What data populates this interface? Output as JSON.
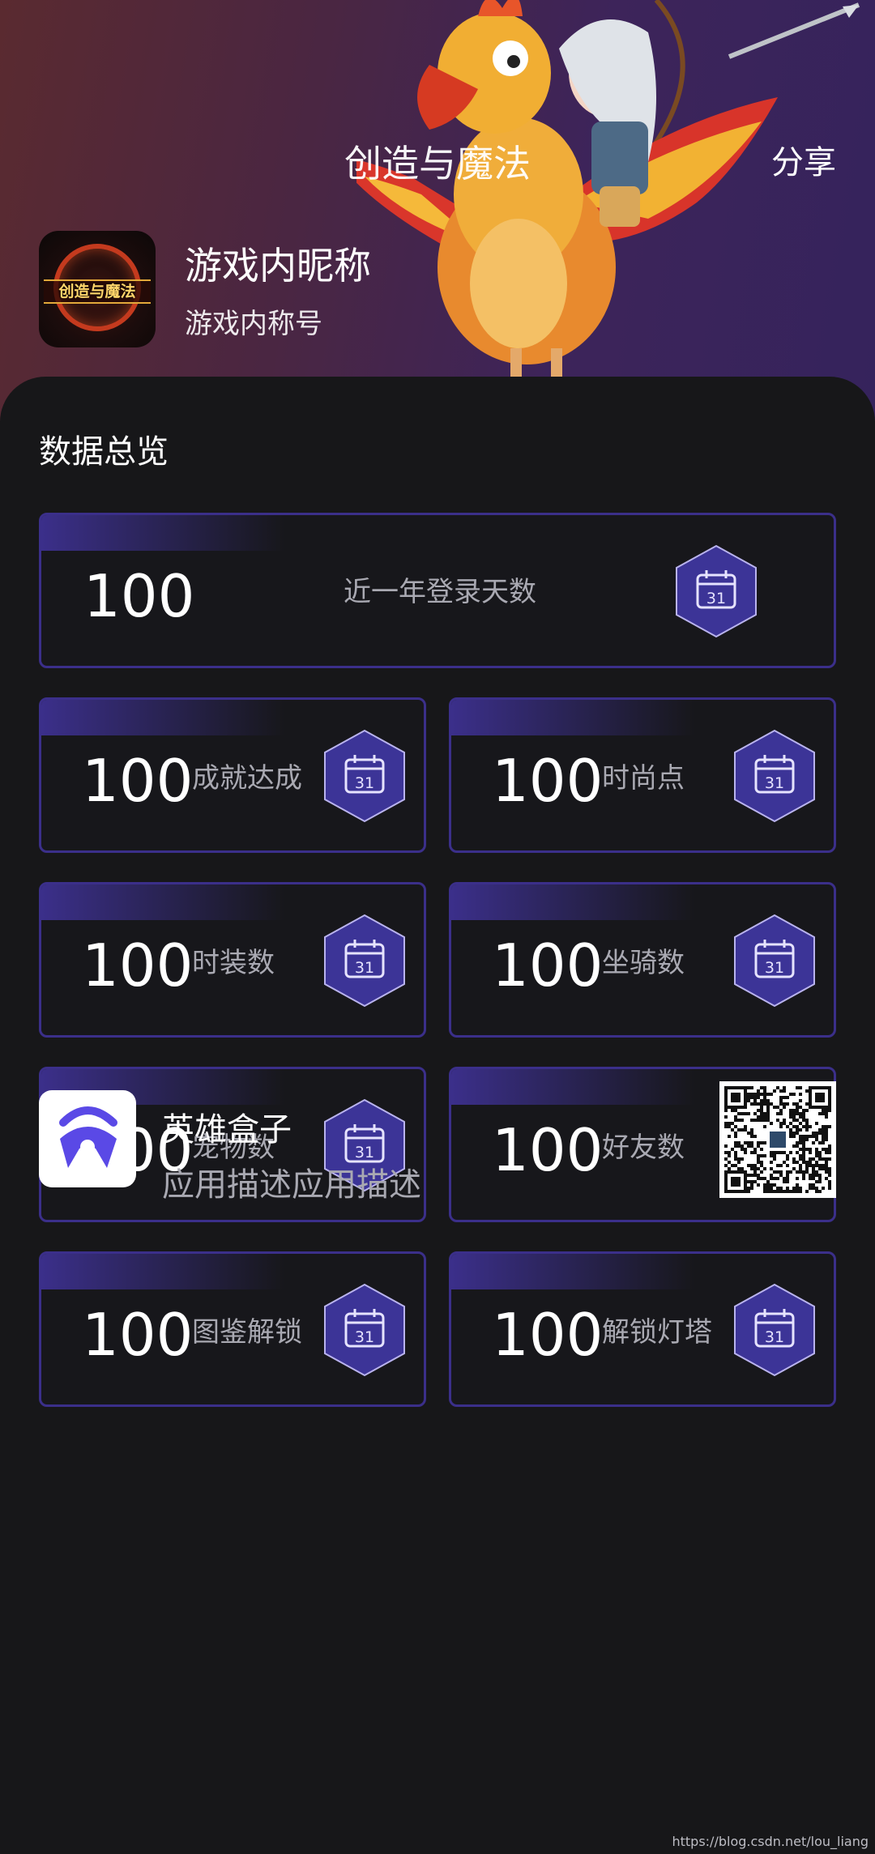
{
  "header": {
    "game_title": "创造与魔法",
    "share_label": "分享",
    "nickname": "游戏内昵称",
    "account": "游戏内称号",
    "game_icon_text": "创造与魔法"
  },
  "overview": {
    "title": "数据总览",
    "primary": {
      "value": "100",
      "label": "近一年登录天数",
      "icon": "calendar-icon"
    },
    "stats": [
      {
        "value": "100",
        "label": "成就达成",
        "icon": "calendar-icon"
      },
      {
        "value": "100",
        "label": "时尚点",
        "icon": "calendar-icon"
      },
      {
        "value": "100",
        "label": "时装数",
        "icon": "calendar-icon"
      },
      {
        "value": "100",
        "label": "坐骑数",
        "icon": "calendar-icon"
      },
      {
        "value": "100",
        "label": "宠物数",
        "icon": "calendar-icon"
      },
      {
        "value": "100",
        "label": "好友数",
        "icon": "calendar-icon"
      },
      {
        "value": "100",
        "label": "图鉴解锁",
        "icon": "calendar-icon"
      },
      {
        "value": "100",
        "label": "解锁灯塔",
        "icon": "calendar-icon"
      }
    ],
    "calendar_day": "31"
  },
  "footer": {
    "app_name": "英雄盒子",
    "app_description": "应用描述应用描述",
    "app_icon": "helmet-icon",
    "qr": "qr-code"
  },
  "watermark": "https://blog.csdn.net/lou_liang",
  "colors": {
    "background": "#171719",
    "card_border": "#3b2f8a",
    "badge_fill": "#3c3497",
    "label_gray": "#a9a9b2",
    "app_icon_accent": "#5a49e6"
  }
}
